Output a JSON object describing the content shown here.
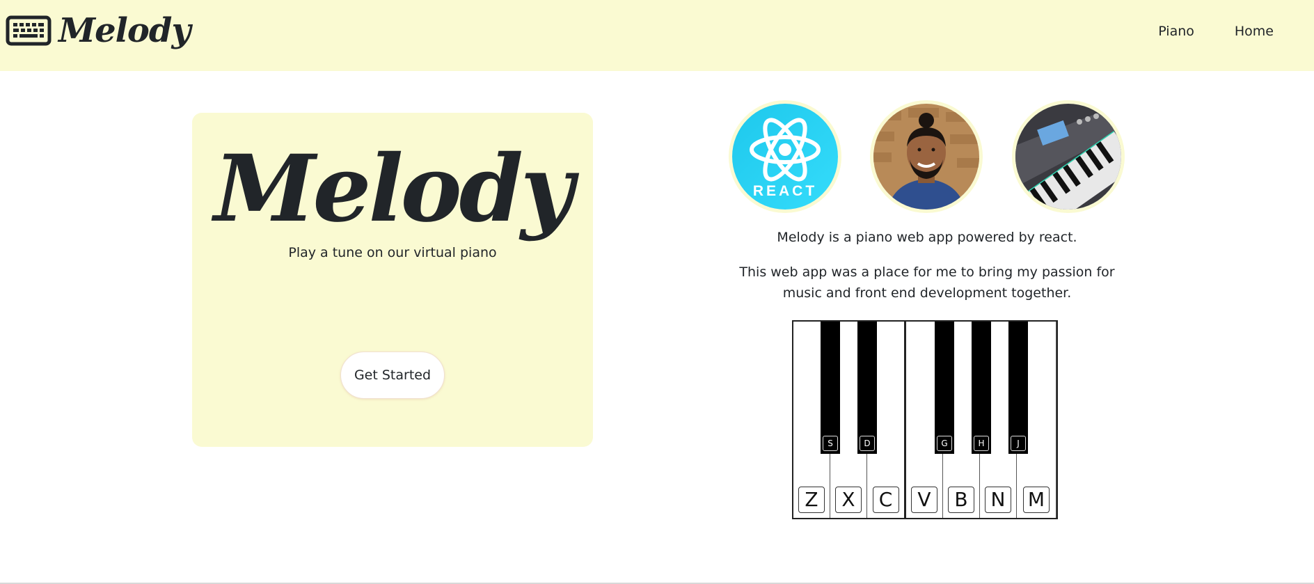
{
  "navbar": {
    "brand": "Melody",
    "brand_icon": "keyboard-icon",
    "links": [
      "Piano",
      "Home"
    ]
  },
  "hero": {
    "title": "Melody",
    "subtitle": "Play a tune on our virtual piano",
    "button": "Get Started"
  },
  "images": {
    "react_logo_text": "REACT",
    "items": [
      "react-logo",
      "developer-photo",
      "keyboard-photo"
    ]
  },
  "about": {
    "line1": "Melody is a piano web app powered by react.",
    "line2": "This web app was a place for me to bring my passion for music and front end development together."
  },
  "piano": {
    "white_keys": [
      "Z",
      "X",
      "C",
      "V",
      "B",
      "N",
      "M"
    ],
    "black_keys": [
      "S",
      "D",
      "G",
      "H",
      "J"
    ]
  },
  "colors": {
    "accent": "#fafad2",
    "react": "#29d0f0",
    "text": "#212529"
  }
}
